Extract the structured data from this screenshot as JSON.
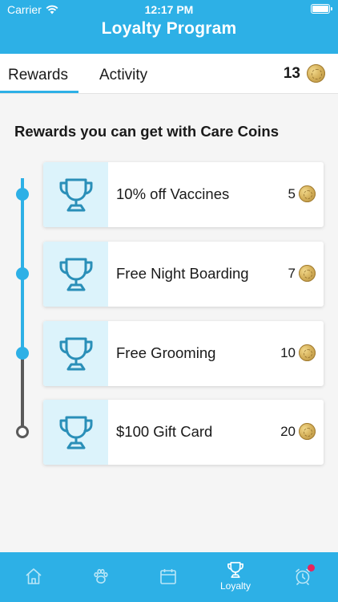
{
  "status_bar": {
    "carrier": "Carrier",
    "time": "12:17 PM"
  },
  "header": {
    "title": "Loyalty Program"
  },
  "tabs": [
    {
      "label": "Rewards",
      "active": true
    },
    {
      "label": "Activity",
      "active": false
    }
  ],
  "balance": {
    "coins": "13"
  },
  "section_title": "Rewards you can get with Care Coins",
  "rewards": [
    {
      "label": "10% off Vaccines",
      "cost": "5"
    },
    {
      "label": "Free Night Boarding",
      "cost": "7"
    },
    {
      "label": "Free Grooming",
      "cost": "10"
    },
    {
      "label": "$100 Gift Card",
      "cost": "20"
    }
  ],
  "bottom_nav": [
    {
      "icon": "home-icon",
      "label": ""
    },
    {
      "icon": "paw-icon",
      "label": ""
    },
    {
      "icon": "calendar-icon",
      "label": ""
    },
    {
      "icon": "trophy-icon",
      "label": "Loyalty",
      "active": true
    },
    {
      "icon": "alarm-clock-icon",
      "label": "",
      "badge": true
    }
  ],
  "colors": {
    "primary": "#2db0e6",
    "icon_bg": "#dcf3fb",
    "icon_stroke": "#2a8fb8",
    "badge": "#e8245c",
    "timeline_inactive": "#5a5a5a"
  }
}
